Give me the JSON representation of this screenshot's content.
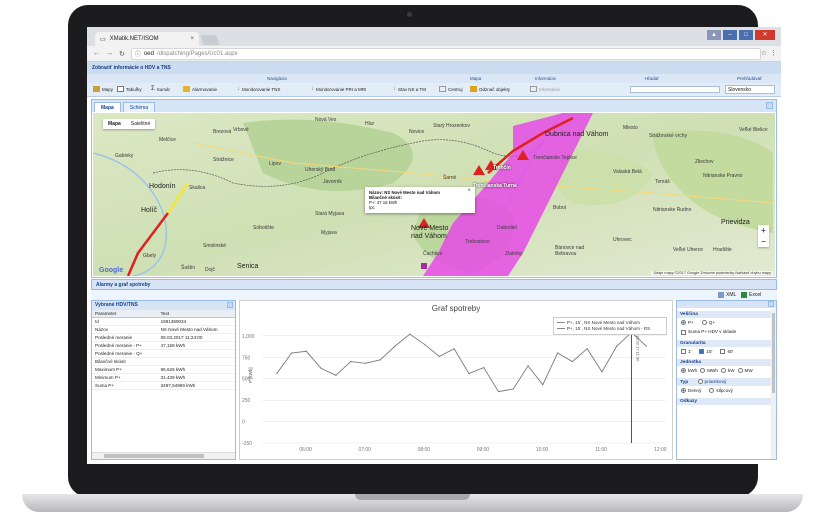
{
  "browser": {
    "tab_title": "XMatik.NET/ISOM",
    "url_host": "oed",
    "url_path": "/dispatching/Pages/Uc01.aspx"
  },
  "app": {
    "title": "Zobraziť informácie o HDV a TNS",
    "toolbar_groups": {
      "navigation": "Navigácia",
      "map": "Mapa",
      "information": "Informácie",
      "search": "Hľadať",
      "search_in": "Prehľadávať"
    },
    "toolbar": {
      "maps": "Mapy",
      "tables": "Tabuľky",
      "summary": "Sumár",
      "alarms": "Alarmovanie",
      "monitor_tns": "Monitorovanie TNS",
      "monitor_pri": "Monitorovanie PRI a MRI",
      "state": "Stav NS a TM",
      "center": "Centruj",
      "show_objects": "Odznač objekty",
      "info_label": "Informácie",
      "country": "Slovensko"
    }
  },
  "map_panel": {
    "tabs": [
      "Mapa",
      "Schéma"
    ],
    "map_types": [
      "Mapa",
      "Satelitné"
    ],
    "places": {
      "nova_ves": "Nová Ves",
      "hlur": "Hlur",
      "vrbove": "Vrbové",
      "brezova": "Brezová",
      "novice": "Novice",
      "stary_hrozenkov": "Starý Hrozenkov",
      "melcice": "Melčice",
      "dubnica": "Dubnica nad Váhom",
      "miesto": "Miesto",
      "velke_bielice": "Veľké Bielice",
      "strazovske": "Strážovské vrchy",
      "gabinky": "Gabinky",
      "straznice": "Strážnice",
      "lipov": "Lipov",
      "trencin": "Trenčín",
      "trencianske_teplice": "Trenčianske Teplice",
      "uhersky_brod": "Uherský Brod",
      "valaska_bela": "Valaská Belá",
      "zliechov": "Zliechov",
      "hodonin": "Hodonín",
      "skalica": "Skalica",
      "javornik": "Javorník",
      "sarne": "Šarné",
      "trencianska_turna": "Trenčianska Turná",
      "tomas": "Tomáš",
      "nitrianske_pravno": "Nitrianske Pravno",
      "senica_small": "Holíč",
      "stara_myjava": "Stará Myjava",
      "mnichova": "Myjava",
      "bobot": "Bobot",
      "nitrianske_rudno": "Nitrianske Rudno",
      "prievidza": "Prievidza",
      "nove_mesto": "Nové Mesto nad Váhom",
      "dubodiel": "Dubodiel",
      "skalica2": "Sobotište",
      "uhrovec": "Uhrovec",
      "smolinske": "Smolinské",
      "banovce": "Bánovce nad Bebravou",
      "cachtice": "Čachtice",
      "zlatniky": "Zlatníky",
      "velcice": "Veľké Uherce",
      "hradiste": "Hradište",
      "sastin": "Šaštín",
      "senica": "Senica",
      "gbely": "Gbely",
      "dojc": "Dojč",
      "tomasovice": "Trebostovo"
    },
    "popup": {
      "line1": "Názov: NS Nové Mesto nad Váhom",
      "line2": "Bilančné skúsit:",
      "line3": "P+: 47.16 kWh",
      "line4": "Ipc"
    },
    "attribution": "Údaje mapy ©2017 Google   Zmluvné podmienky   Nahlásiť chybu mapy",
    "google": "Google"
  },
  "bottom": {
    "header": "Alarmy a graf spotreby",
    "export_xml": "XML",
    "export_excel": "Excel"
  },
  "left_panel": {
    "title": "Vybrané HDV/TNS",
    "columns": [
      "Parameter",
      "Text"
    ],
    "rows": [
      [
        "Id",
        "1991369034"
      ],
      [
        "Názov",
        "NS Nové Mesto nad Váhom"
      ],
      [
        "Posledné meranie",
        "08.03.2017 11:24:00"
      ],
      [
        "Posledné meranie - P+",
        "47,158 kWh"
      ],
      [
        "Posledné meranie - Q+",
        ""
      ],
      [
        "Bilančné skúsit",
        ""
      ],
      [
        "Maximum P+",
        "95,626 kWh"
      ],
      [
        "Minimum P+",
        "31,439 kWh"
      ],
      [
        "Suma P+",
        "3497,54969 kWh"
      ]
    ]
  },
  "chart_data": {
    "type": "line",
    "title": "Graf spotreby",
    "ylabel": "P [kWh]",
    "xlabel": "",
    "x": [
      "05:30",
      "05:45",
      "06:00",
      "06:15",
      "06:30",
      "06:45",
      "07:00",
      "07:15",
      "07:30",
      "07:45",
      "08:00",
      "08:15",
      "08:30",
      "08:45",
      "09:00",
      "09:15",
      "09:30",
      "09:45",
      "10:00",
      "10:15",
      "10:30",
      "10:45",
      "11:00",
      "11:15",
      "11:30",
      "11:45"
    ],
    "x_ticks": [
      "06:00",
      "07:00",
      "08:00",
      "09:00",
      "10:00",
      "11:00",
      "12:00"
    ],
    "y_ticks": [
      1000,
      750,
      500,
      250,
      0,
      -250
    ],
    "ylim": [
      -250,
      1150
    ],
    "series": [
      {
        "name": "P+, 15´, NS Nové Mesto nad Váhom",
        "values": [
          560,
          800,
          820,
          620,
          540,
          700,
          680,
          720,
          880,
          1020,
          900,
          760,
          850,
          560,
          630,
          350,
          380,
          650,
          430,
          800,
          700,
          850,
          580,
          880,
          1040,
          880
        ]
      },
      {
        "name": "P+, 15´, NS Nové Mesto nad Váhom - RS",
        "values": []
      }
    ],
    "marker_label": "13.02.17 11:30",
    "grid": true,
    "legend_position": "top-right"
  },
  "right_panel": {
    "groups": [
      {
        "title": "Veličina",
        "options": [
          "P+",
          "Q+"
        ],
        "selected": "P+",
        "extra_check": "Suma P+ HDV v sklade"
      },
      {
        "title": "Granularita",
        "options": [
          "1'",
          "15'",
          "60'"
        ],
        "selected": "15'"
      },
      {
        "title": "Jednotka",
        "options": [
          "kWh",
          "MWh",
          "kW",
          "MW"
        ],
        "selected": "kWh"
      },
      {
        "title": "Typ",
        "options": [
          "Denný",
          "stĺpcový"
        ],
        "selected": "Denný",
        "extra": "priamkový"
      },
      {
        "title": "Odkazy",
        "options": []
      }
    ]
  },
  "colors": {
    "accent": "#15428b",
    "header_bg": "#d6e4f5",
    "magenta_zone": "#e64be6",
    "route_red": "#e02020",
    "route_yellow": "#f4e63a"
  }
}
